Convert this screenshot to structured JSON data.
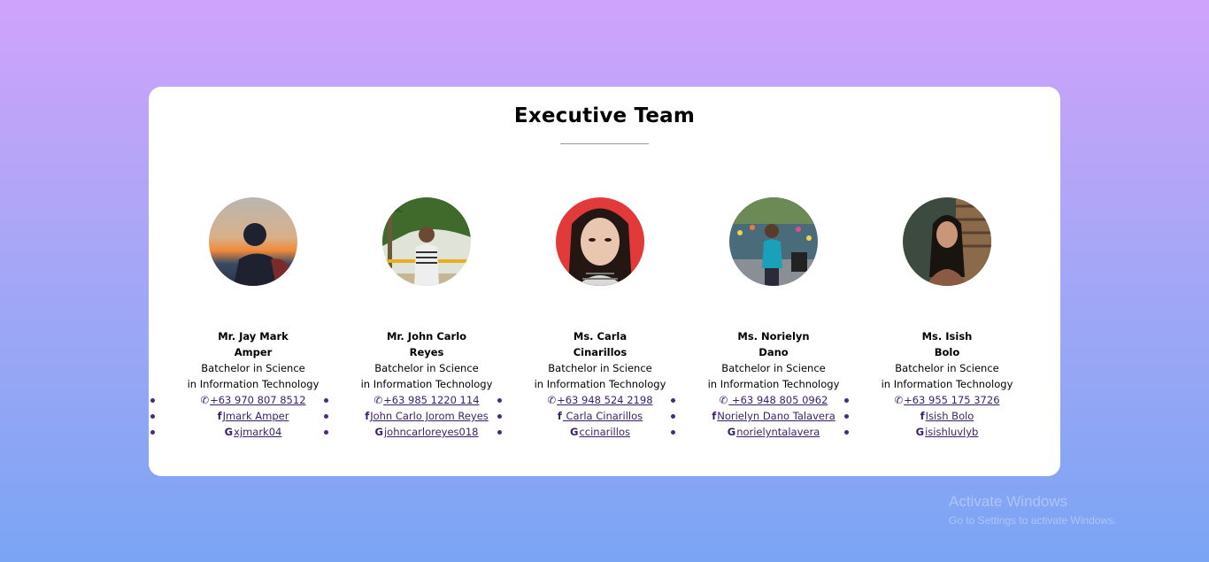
{
  "section": {
    "title": "Executive Team"
  },
  "members": [
    {
      "name_line1": "Mr. Jay Mark",
      "name_line2": "Amper",
      "degree_line1": "Batchelor in Science",
      "degree_line2": "in Information Technology",
      "phone": "+63 970 807 8512",
      "facebook": "Jmark Amper",
      "google": "xjmark04"
    },
    {
      "name_line1": "Mr. John Carlo",
      "name_line2": "Reyes",
      "degree_line1": "Batchelor in Science",
      "degree_line2": "in Information Technology",
      "phone": "+63 985 1220 114",
      "facebook": "John Carlo Jorom Reyes",
      "google": "johncarloreyes018"
    },
    {
      "name_line1": "Ms. Carla",
      "name_line2": "Cinarillos",
      "degree_line1": "Batchelor in Science",
      "degree_line2": "in Information Technology",
      "phone": "+63 948 524 2198",
      "facebook": " Carla Cinarillos",
      "google": "ccinarillos"
    },
    {
      "name_line1": "Ms. Norielyn",
      "name_line2": "Dano",
      "degree_line1": "Batchelor in Science",
      "degree_line2": "in Information Technology",
      "phone": " +63 948 805 0962",
      "facebook": "Norielyn Dano Talavera",
      "google": "norielyntalavera"
    },
    {
      "name_line1": "Ms. Isish",
      "name_line2": "Bolo",
      "degree_line1": "Batchelor in Science",
      "degree_line2": "in Information Technology",
      "phone": "+63 955 175 3726",
      "facebook": "Isish Bolo",
      "google": "isishluvlyb"
    }
  ],
  "icons": {
    "phone": "phone-icon",
    "facebook": "facebook-icon",
    "google": "google-icon"
  },
  "watermark": {
    "line1": "Activate Windows",
    "line2": "Go to Settings to activate Windows."
  },
  "colors": {
    "link": "#3b1f6b",
    "bg_top": "#d0a3fb",
    "bg_bottom": "#7aa5f4"
  }
}
